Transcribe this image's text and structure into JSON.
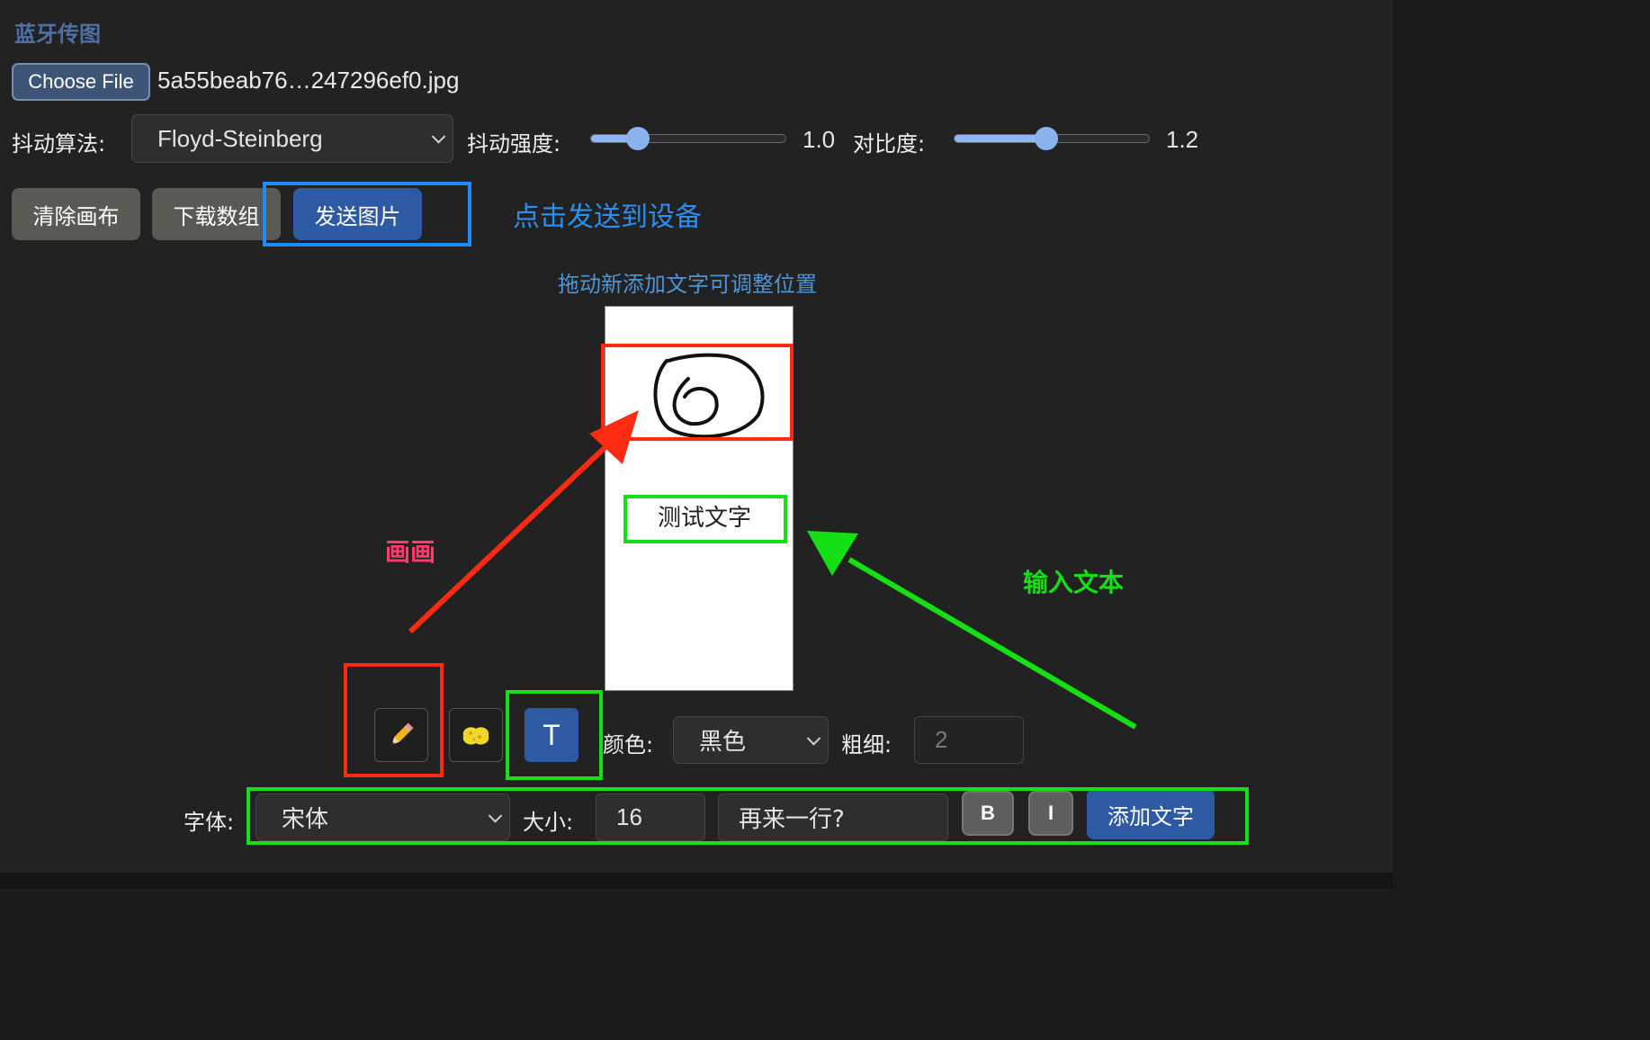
{
  "app": {
    "title": "蓝牙传图"
  },
  "file": {
    "button_label": "Choose File",
    "file_name": "5a55beab76…247296ef0.jpg"
  },
  "dither": {
    "algorithm_label": "抖动算法:",
    "algorithm_value": "Floyd-Steinberg",
    "strength_label": "抖动强度:",
    "strength_value": "1.0",
    "strength_fraction": 0.24,
    "contrast_label": "对比度:",
    "contrast_value": "1.2",
    "contrast_fraction": 0.47
  },
  "actions": {
    "clear_label": "清除画布",
    "download_label": "下载数组",
    "send_label": "发送图片"
  },
  "annotations": {
    "send_hint": "点击发送到设备",
    "drag_hint": "拖动新添加文字可调整位置",
    "draw_hint": "画画",
    "text_hint": "输入文本",
    "colors": {
      "red": "#ff2a12",
      "blue": "#1e8cff",
      "green": "#15e015",
      "pink": "#ff3b6b",
      "hint_blue": "#4d95d6"
    }
  },
  "canvas": {
    "text": "测试文字"
  },
  "tools": {
    "pencil_icon": "pencil-icon",
    "eraser_icon": "sponge-icon",
    "text_tool_label": "T",
    "color_label": "颜色:",
    "color_value": "黑色",
    "width_label": "粗细:",
    "width_value": "2"
  },
  "text_tools": {
    "font_label": "字体:",
    "font_value": "宋体",
    "size_label": "大小:",
    "size_value": "16",
    "text_value": "再来一行?",
    "bold_label": "B",
    "italic_label": "I",
    "add_label": "添加文字"
  }
}
